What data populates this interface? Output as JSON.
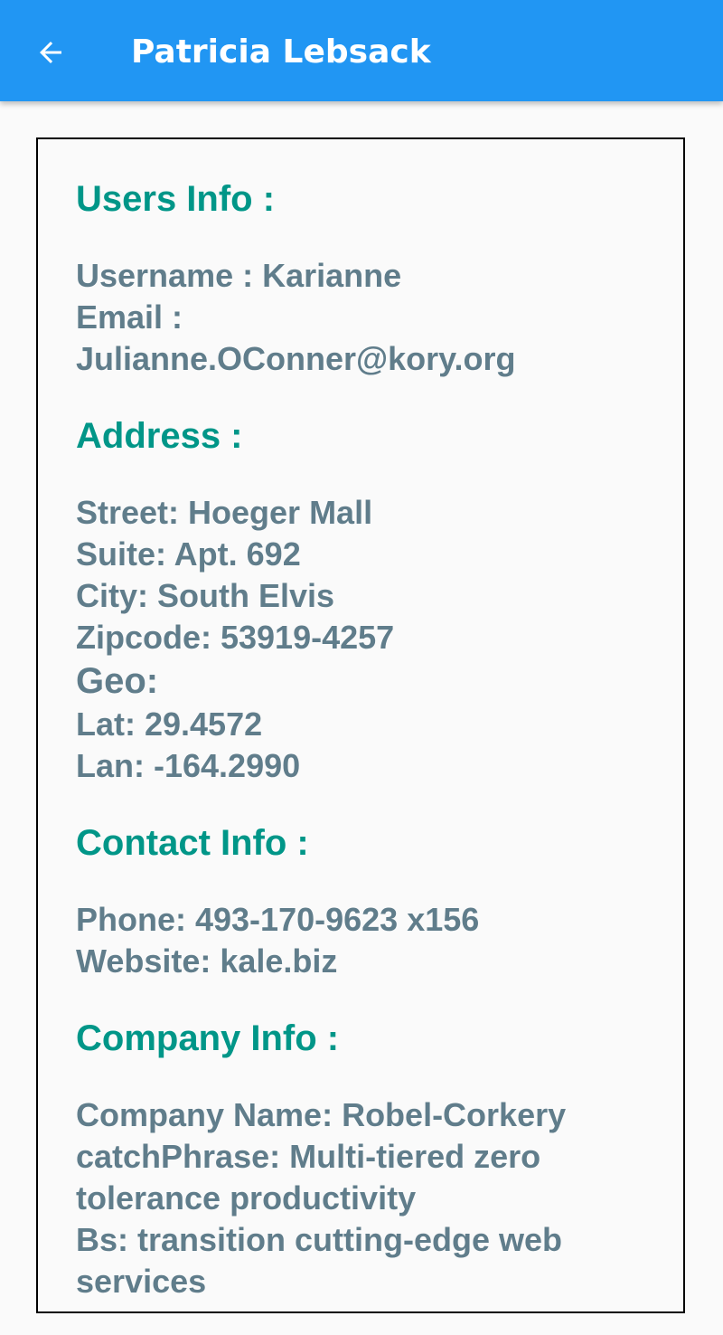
{
  "appbar": {
    "back_icon": "arrow-left-icon",
    "title": "Patricia Lebsack"
  },
  "users_info": {
    "heading": "Users Info :",
    "username": "Username : Karianne",
    "email_label": "Email :",
    "email_value": "Julianne.OConner@kory.org"
  },
  "address": {
    "heading": "Address :",
    "street": "Street: Hoeger Mall",
    "suite": "Suite: Apt. 692",
    "city": "City: South Elvis",
    "zipcode": "Zipcode: 53919-4257",
    "geo_label": "Geo:",
    "lat": "Lat: 29.4572",
    "lan": "Lan: -164.2990"
  },
  "contact": {
    "heading": "Contact Info :",
    "phone": "Phone: 493-170-9623 x156",
    "website": "Website: kale.biz"
  },
  "company": {
    "heading": "Company Info :",
    "name": "Company Name: Robel-Corkery",
    "catch_phrase": "catchPhrase: Multi-tiered zero tolerance productivity",
    "bs": "Bs: transition cutting-edge web services"
  },
  "colors": {
    "appbar": "#2196f3",
    "heading": "#009688",
    "body_text": "#607d8b"
  }
}
